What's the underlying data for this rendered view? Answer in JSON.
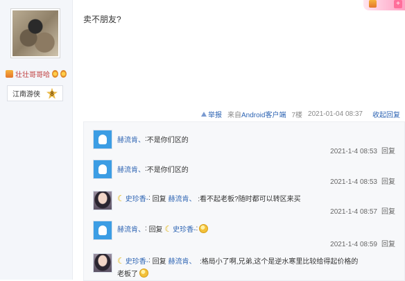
{
  "top_badge": {
    "icon": "crown-icon",
    "label": "+"
  },
  "author": {
    "name": "壮壮哥哥哈",
    "level_name": "江南游侠",
    "level_number": "8"
  },
  "post": {
    "text": "卖不朋友?",
    "meta": {
      "report": "举报",
      "source_prefix": "来自",
      "source_device": "Android客户端",
      "floor": "7楼",
      "datetime": "2021-01-04 08:37",
      "collapse": "收起回复"
    }
  },
  "replies": [
    {
      "avatar": "default",
      "name": "赫流肯、",
      "sep": ":",
      "text": "不是你们区的",
      "time": "2021-1-4 08:53",
      "action": "回复"
    },
    {
      "avatar": "default",
      "name": "赫流肯、",
      "sep": ":",
      "text": "不是你们区的",
      "time": "2021-1-4 08:53",
      "action": "回复"
    },
    {
      "avatar": "photo",
      "name": "史珍香-",
      "sep": ":",
      "reply_word": "回复",
      "target": "赫流肯、",
      "text": ":看不起老板?随时都可以转区来买",
      "time": "2021-1-4 08:57",
      "action": "回复"
    },
    {
      "avatar": "default",
      "name": "赫流肯、",
      "sep": ":",
      "reply_word": "回复",
      "target": "史珍香-",
      "text": ":",
      "time": "2021-1-4 08:59",
      "action": "回复"
    },
    {
      "avatar": "photo",
      "name": "史珍香-",
      "sep": ":",
      "reply_word": "回复",
      "target": "赫流肯、",
      "text": ":格局小了啊,兄弟,这个是逆水寒里比较给得起价格的",
      "text2": "老板了",
      "time": "",
      "action": ""
    }
  ]
}
